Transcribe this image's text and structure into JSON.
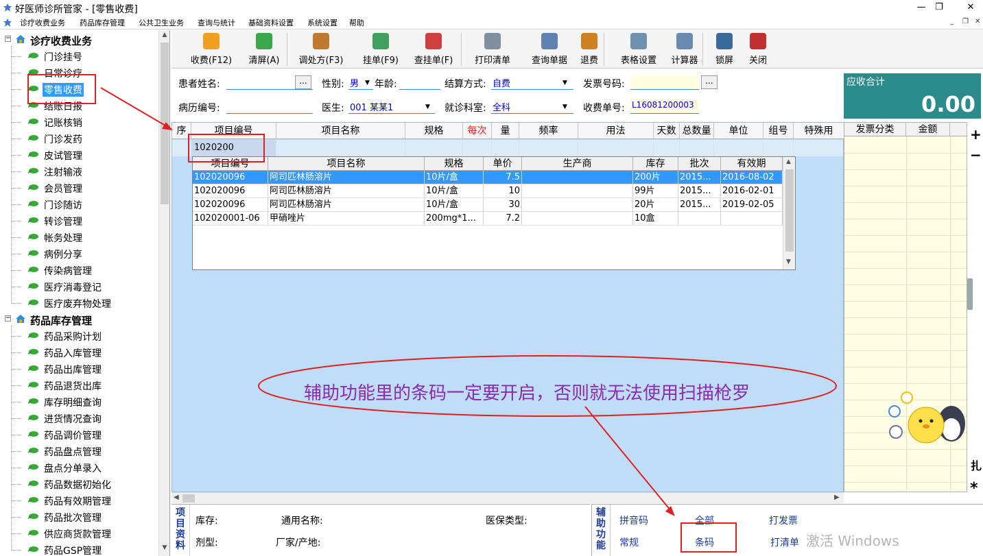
{
  "window": {
    "title": "好医师诊所管家 - [零售收费]"
  },
  "menu": [
    "诊疗收费业务",
    "药品库存管理",
    "公共卫生业务",
    "查询与统计",
    "基础资料设置",
    "系统设置",
    "帮助"
  ],
  "tree": {
    "groups": [
      {
        "label": "诊疗收费业务",
        "items": [
          "门诊挂号",
          "日常诊疗",
          "零售收费",
          "结账日报",
          "记账核销",
          "门诊发药",
          "皮试管理",
          "注射输液",
          "会员管理",
          "门诊随访",
          "转诊管理",
          "帐务处理",
          "病例分享",
          "传染病管理",
          "医疗消毒登记",
          "医疗废弃物处理"
        ]
      },
      {
        "label": "药品库存管理",
        "items": [
          "药品采购计划",
          "药品入库管理",
          "药品出库管理",
          "药品退货出库",
          "库存明细查询",
          "进货情况查询",
          "药品调价管理",
          "药品盘点管理",
          "盘点分单录入",
          "药品数据初始化",
          "药品有效期管理",
          "药品批次管理",
          "供应商货款管理",
          "药品GSP管理"
        ]
      }
    ],
    "selected": "零售收费"
  },
  "toolbar": [
    {
      "label": "收费(F12)",
      "icon": "coin-icon",
      "color": "#f0a020"
    },
    {
      "label": "清屏(A)",
      "icon": "refresh-icon",
      "color": "#3aa84a"
    },
    {
      "label": "调处方(F3)",
      "icon": "people-icon",
      "color": "#c07a30"
    },
    {
      "label": "挂单(F9)",
      "icon": "doc-up-icon",
      "color": "#40a060"
    },
    {
      "label": "查挂单(F)",
      "icon": "doc-plus-icon",
      "color": "#d04040"
    },
    {
      "label": "打印清单",
      "icon": "printer-icon",
      "color": "#8090a0"
    },
    {
      "label": "查询单据",
      "icon": "doc-search-icon",
      "color": "#6080b0"
    },
    {
      "label": "退费",
      "icon": "refund-icon",
      "color": "#d08020"
    },
    {
      "label": "表格设置",
      "icon": "gear-icon",
      "color": "#7090b0"
    },
    {
      "label": "计算器",
      "icon": "calculator-icon",
      "color": "#6a8ab0"
    },
    {
      "label": "锁屏",
      "icon": "monitor-icon",
      "color": "#3a6a9a"
    },
    {
      "label": "关闭",
      "icon": "exit-icon",
      "color": "#c03030"
    }
  ],
  "form": {
    "patient_name_label": "患者姓名:",
    "gender_label": "性别:",
    "gender_value": "男",
    "age_label": "年龄:",
    "settle_label": "结算方式:",
    "settle_value": "自费",
    "invoice_label": "发票号码:",
    "record_label": "病历编号:",
    "doctor_label": "医生:",
    "doctor_value": "001 某某1",
    "dept_label": "就诊科室:",
    "dept_value": "全科",
    "charge_no_label": "收费单号:",
    "charge_no_value": "L16081200003",
    "more_btn": "..."
  },
  "total": {
    "label": "应收合计",
    "value": "0.00"
  },
  "grid": {
    "columns": [
      "序",
      "项目编号",
      "项目名称",
      "规格",
      "每次",
      "量",
      "频率",
      "用法",
      "天数",
      "总数量",
      "单位",
      "组号",
      "特殊用"
    ],
    "row_code": "1020200",
    "highlight_col": "每次",
    "highlight_color": "#e02020"
  },
  "popup": {
    "columns": [
      "项目编号",
      "项目名称",
      "规格",
      "单价",
      "生产商",
      "库存",
      "批次",
      "有效期"
    ],
    "rows": [
      [
        "102020096",
        "阿司匹林肠溶片",
        "10片/盒",
        "7.5",
        "",
        "200片",
        "2015...",
        "2016-08-02"
      ],
      [
        "102020096",
        "阿司匹林肠溶片",
        "10片/盒",
        "10",
        "",
        "99片",
        "2015...",
        "2016-02-01"
      ],
      [
        "102020096",
        "阿司匹林肠溶片",
        "10片/盒",
        "30",
        "",
        "20片",
        "2015...",
        "2019-02-05"
      ],
      [
        "102020001-06",
        "甲硝唑片",
        "200mg*1...",
        "7.2",
        "",
        "10盒",
        "",
        ""
      ]
    ]
  },
  "right_panel": {
    "columns": [
      "发票分类",
      "金额"
    ],
    "plus": "+",
    "minus": "−",
    "star": "*",
    "side_text": "扎"
  },
  "info": {
    "section": "项目资料",
    "stock_label": "库存:",
    "generic_label": "通用名称:",
    "insurance_label": "医保类型:",
    "form_label": "剂型:",
    "maker_label": "厂家/产地:"
  },
  "aux": {
    "section": "辅助功能",
    "pinyin": "拼音码",
    "all": "全部",
    "print_invoice": "打发票",
    "normal": "常规",
    "barcode": "条码",
    "print_list": "打清单"
  },
  "annotation": {
    "note": "辅助功能里的条码一定要开启，否则就无法使用扫描枪罗",
    "color": "#8a2bb0"
  },
  "watermark": {
    "line1": "激活 Windows"
  }
}
